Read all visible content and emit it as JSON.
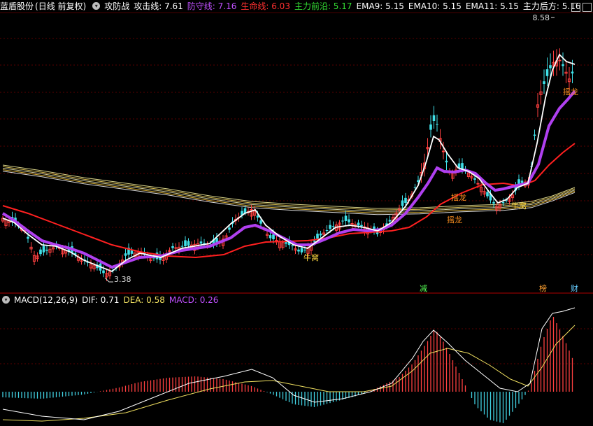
{
  "header": {
    "stock_name": "蓝盾股份",
    "period": "(日线 前复权)",
    "indicator_name": "攻防战",
    "items": [
      {
        "label": "攻击线: 7.61",
        "color": "#ffffff"
      },
      {
        "label": "防守线: 7.16",
        "color": "#c050ff"
      },
      {
        "label": "生命线: 6.03",
        "color": "#ff3030"
      },
      {
        "label": "主力前沿: 5.17",
        "color": "#33dd33"
      },
      {
        "label": "EMA9: 5.15",
        "color": "#ffffff"
      },
      {
        "label": "EMA10: 5.15",
        "color": "#ffffff"
      },
      {
        "label": "EMA11: 5.15",
        "color": "#ffffff"
      },
      {
        "label": "主力后方: 5.16",
        "color": "#ffffff"
      }
    ]
  },
  "macd_header": {
    "name": "MACD(12,26,9)",
    "items": [
      {
        "label": "DIF: 0.71",
        "color": "#ffffff"
      },
      {
        "label": "DEA: 0.58",
        "color": "#f0e060"
      },
      {
        "label": "MACD: 0.26",
        "color": "#c050ff"
      }
    ]
  },
  "chart_data": [
    {
      "type": "candlestick",
      "title": "蓝盾股份 (日线 前复权)",
      "price_low": 3.38,
      "price_high": 8.58,
      "ylim": [
        3.0,
        9.0
      ],
      "grid": true,
      "annotations": [
        {
          "text": "3.38",
          "kind": "low"
        },
        {
          "text": "8.58",
          "kind": "high"
        },
        {
          "text": "牛窝",
          "color": "#ffd740"
        },
        {
          "text": "牛窝",
          "color": "#ffd740"
        },
        {
          "text": "摇龙",
          "color": "#ff9020"
        },
        {
          "text": "摇龙",
          "color": "#ff9020"
        },
        {
          "text": "摇龙",
          "color": "#ff9020"
        }
      ],
      "signals": [
        {
          "text": "减",
          "color": "#55ff55"
        },
        {
          "text": "榜",
          "color": "#ffa030"
        },
        {
          "text": "财",
          "color": "#66ccff"
        }
      ],
      "series": [
        {
          "name": "攻击线",
          "color": "#ffffff"
        },
        {
          "name": "防守线",
          "color": "#c050ff"
        },
        {
          "name": "生命线",
          "color": "#ff3030"
        },
        {
          "name": "主力前沿",
          "color": "#33dd33"
        },
        {
          "name": "EMA9",
          "color": "#ffffff"
        },
        {
          "name": "EMA10",
          "color": "#ffffff"
        },
        {
          "name": "EMA11",
          "color": "#ffffff"
        },
        {
          "name": "主力后方",
          "color": "#ffffff"
        }
      ]
    },
    {
      "type": "macd",
      "title": "MACD(12,26,9)",
      "series": [
        {
          "name": "DIF",
          "last": 0.71,
          "color": "#ffffff"
        },
        {
          "name": "DEA",
          "last": 0.58,
          "color": "#f0e060"
        },
        {
          "name": "MACD",
          "last": 0.26,
          "color": "#c050ff"
        }
      ]
    }
  ]
}
